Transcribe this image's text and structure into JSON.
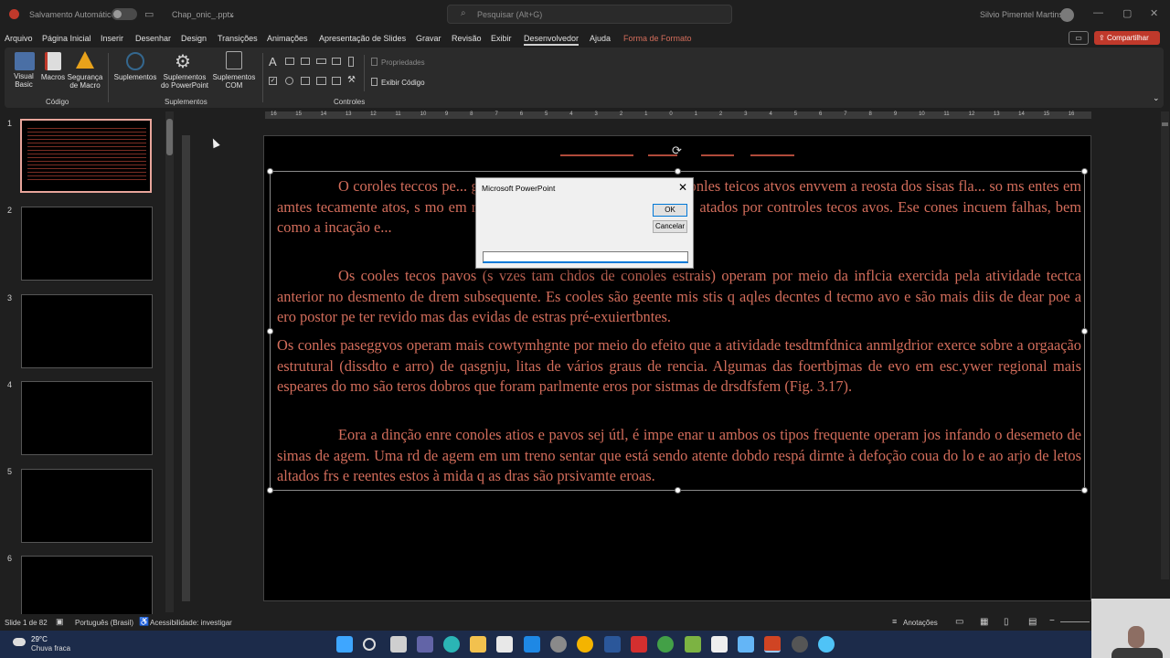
{
  "titlebar": {
    "autosave": "Salvamento Automático",
    "filename": "Chap_onic_.pptx",
    "search_placeholder": "Pesquisar (Alt+G)",
    "user": "Silvio Pimentel Martins"
  },
  "menu": [
    "Arquivo",
    "Página Inicial",
    "Inserir",
    "Desenhar",
    "Design",
    "Transições",
    "Animações",
    "Apresentação de Slides",
    "Gravar",
    "Revisão",
    "Exibir",
    "Desenvolvedor",
    "Ajuda",
    "Forma de Formato"
  ],
  "share_label": "Compartilhar",
  "ribbon": {
    "visual_basic": "Visual Basic",
    "macros": "Macros",
    "macro_security": "Segurança de Macro",
    "group_code": "Código",
    "addins": "Suplementos",
    "ppt_addins": "Suplementos do PowerPoint",
    "com_addins": "Suplementos COM",
    "group_addins": "Suplementos",
    "group_controls": "Controles",
    "properties": "Propriedades",
    "view_code": "Exibir Código"
  },
  "thumbnails": [
    "1",
    "2",
    "3",
    "4",
    "5",
    "6"
  ],
  "dialog": {
    "title": "Microsoft PowerPoint",
    "ok": "OK",
    "cancel": "Cancelar",
    "input_value": ""
  },
  "slide_text": {
    "p1": "O coroles teccos pe... gem d duas mairas (Tala 16.1). Os conles teicos atvos envvem a reosta dos sisas fla... so ms entes em amtes tecamente atos, s mo em rees apente tectnte quiescentes, os ... atados por controles tecos avos. Ese cones incuem falhas, bem como a incação e...",
    "p2": "Os cooles tecos pavos (s vzes tam chdos de conoles estrais) operam por meio da inflcia exercida pela atividade tectca anterior no desmento de drem subsequente. Es cooles são geente mis stis  q aqles decntes d tecmo avo e são mais diis de dear poe a ero postor pe ter revido mas das evidas de estras pré-exuiertbntes.",
    "p3": "Os conles paseggvos operam mais cowtymhgnte por meio do efeito que a atividade tesdtmfdnica anmlgdrior exerce sobre a orgaação estrutural (dissdto e arro) de qasgnju, litas de vários graus de rencia. Algumas das foertbjmas de evo em esc.ywer regional mais espeares do mo são teros dobros que foram parlmente eros por sistmas de drsdfsfem (Fig. 3.17).",
    "p4": "Eora a dinção enre conoles atios e pavos sej útl, é impe enar u ambos os tipos frequente operam jos infando o desemeto de simas de agem. Uma rd de agem em um treno sentar que está sendo atente dobdo respá dirnte à defoção coua do lo e ao arjo de letos altados frs e reentes estos à mida q as dras são prsivamte eroas."
  },
  "ruler_numbers": [
    "16",
    "15",
    "14",
    "13",
    "12",
    "11",
    "10",
    "9",
    "8",
    "7",
    "6",
    "5",
    "4",
    "3",
    "2",
    "1",
    "0",
    "1",
    "2",
    "3",
    "4",
    "5",
    "6",
    "7",
    "8",
    "9",
    "10",
    "11",
    "12",
    "13",
    "14",
    "15",
    "16"
  ],
  "status": {
    "slide_info": "Slide 1 de 82",
    "language": "Português (Brasil)",
    "accessibility": "Acessibilidade: investigar",
    "notes": "Anotações"
  },
  "weather": {
    "temp": "29°C",
    "desc": "Chuva fraca"
  },
  "colors": {
    "accent_red": "#d36d5b",
    "share_btn": "#c0392b",
    "selected_thumb": "#e8a59b"
  }
}
